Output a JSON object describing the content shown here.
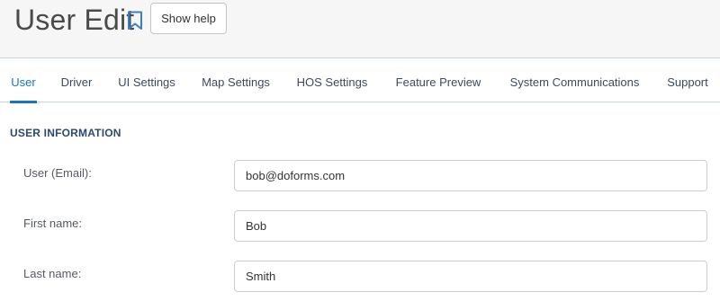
{
  "header": {
    "title": "User Edit",
    "bookmark_icon": "bookmark-icon",
    "help_button_label": "Show help"
  },
  "tabs": [
    {
      "label": "User",
      "active": true
    },
    {
      "label": "Driver"
    },
    {
      "label": "UI Settings"
    },
    {
      "label": "Map Settings"
    },
    {
      "label": "HOS Settings"
    },
    {
      "label": "Feature Preview"
    },
    {
      "label": "System Communications"
    },
    {
      "label": "Support"
    }
  ],
  "section": {
    "title": "USER INFORMATION"
  },
  "fields": [
    {
      "label": "User (Email):",
      "value": "bob@doforms.com"
    },
    {
      "label": "First name:",
      "value": "Bob"
    },
    {
      "label": "Last name:",
      "value": "Smith"
    }
  ],
  "colors": {
    "accent": "#1a73c6",
    "section_title": "#2c4a6e",
    "header_bg": "#f6f6f7"
  }
}
